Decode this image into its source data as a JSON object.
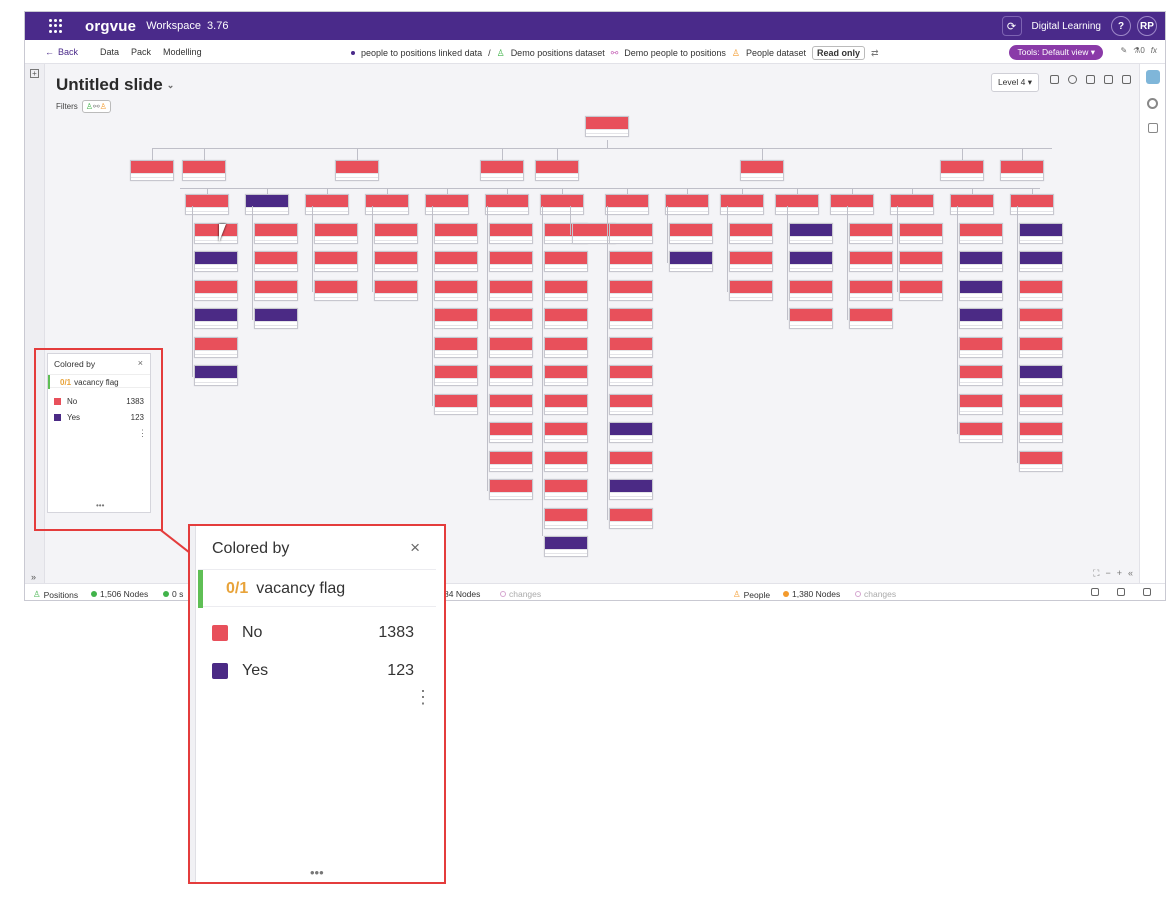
{
  "app": {
    "logo": "orgvue",
    "workspace": "Workspace",
    "version": "3.76",
    "org_name": "Digital Learning",
    "help": "?",
    "user_initials": "RP"
  },
  "nav": {
    "back": "Back",
    "links": [
      "Data",
      "Pack",
      "Modelling"
    ],
    "crumbs": [
      "people to positions linked data",
      "/",
      "Demo positions dataset",
      "Demo people to positions",
      "People dataset"
    ],
    "read_only": "Read only",
    "tools": "Tools: Default view",
    "pin_count": "0",
    "fx": "fx"
  },
  "slide": {
    "title": "Untitled slide",
    "filters_label": "Filters",
    "level": "Level 4"
  },
  "status": {
    "positions_label": "Positions",
    "positions_nodes": "1,506 Nodes",
    "partial_s": "0 s",
    "mid_nodes": "84 Nodes",
    "changes_1": "changes",
    "people_label": "People",
    "people_nodes": "1,380 Nodes",
    "changes_2": "changes"
  },
  "legend": {
    "title": "Colored by",
    "close": "×",
    "field_prefix": "0/1",
    "field_name": "vacancy flag",
    "items": [
      {
        "label": "No",
        "count": "1383",
        "color": "#e8505b"
      },
      {
        "label": "Yes",
        "count": "123",
        "color": "#4b2a85"
      }
    ],
    "more": "•••",
    "kebab": "⋮"
  },
  "colors": {
    "brand": "#4a2a8a",
    "no": "#e8505b",
    "yes": "#4b2a85",
    "callout": "#e43c3c"
  }
}
